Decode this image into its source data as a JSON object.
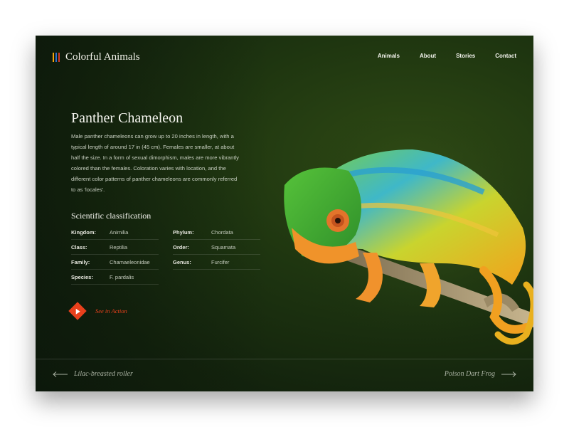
{
  "brand": {
    "name": "Colorful Animals",
    "logo_colors": [
      "#f2a20c",
      "#2f6fd0",
      "#d23a2a"
    ]
  },
  "nav": {
    "items": [
      "Animals",
      "About",
      "Stories",
      "Contact"
    ]
  },
  "hero": {
    "title": "Panther Chameleon",
    "description": "Male panther chameleons can grow up to 20 inches in length, with a typical length of around 17 in (45 cm). Females are smaller, at about half the size. In a form of sexual dimorphism, males are more vibrantly colored than the females. Coloration varies with location, and the different color patterns of panther chameleons are commonly referred to as 'locales'."
  },
  "classification": {
    "heading": "Scientific classification",
    "rows": [
      {
        "key": "Kingdom:",
        "value": "Animilia"
      },
      {
        "key": "Phylum:",
        "value": "Chordata"
      },
      {
        "key": "Class:",
        "value": "Reptilia"
      },
      {
        "key": "Order:",
        "value": "Squamata"
      },
      {
        "key": "Family:",
        "value": "Chamaeleonidae"
      },
      {
        "key": "Genus:",
        "value": "Furcifer"
      },
      {
        "key": "Species:",
        "value": "F. pardalis"
      }
    ]
  },
  "cta": {
    "label": "See in Action",
    "color": "#e8401c",
    "icon": "play-icon"
  },
  "pager": {
    "prev_label": "Lilac-breasted roller",
    "next_label": "Poison Dart Frog",
    "prev_icon": "arrow-left-icon",
    "next_icon": "arrow-right-icon"
  },
  "image": {
    "subject": "chameleon-photo"
  }
}
